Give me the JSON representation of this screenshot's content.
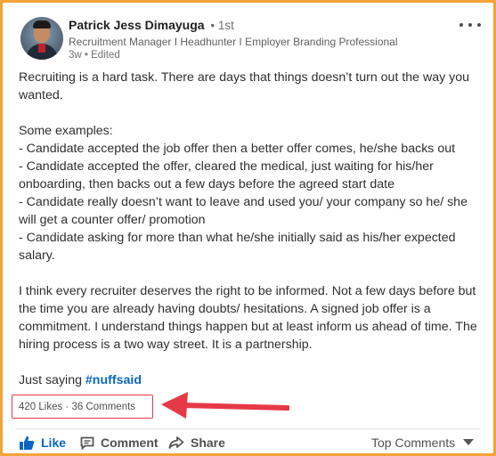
{
  "post": {
    "author": {
      "name": "Patrick Jess Dimayuga",
      "connection_degree": "• 1st",
      "headline": "Recruitment Manager I Headhunter I Employer Branding Professional",
      "meta": "3w • Edited"
    },
    "paragraphs": [
      "Recruiting is a hard task. There are days that things doesn’t turn out the way you wanted.",
      "Some examples:\n- Candidate accepted the job offer then a better offer comes, he/she backs out\n- Candidate accepted the offer, cleared the medical, just waiting for his/her onboarding, then backs out a few days before the agreed start date\n- Candidate really doesn’t want to leave and used you/ your company so he/ she will get a counter offer/ promotion\n- Candidate asking for more than what he/she initially said as his/her expected salary.",
      "I think every recruiter deserves the right to be informed. Not a few days before but the time you are already having doubts/ hesitations. A signed job offer is a commitment. I understand things happen but at least inform us ahead of time. The hiring process is a two way street. It is a partnership."
    ],
    "closing_text": "Just saying ",
    "hashtag": "#nuffsaid",
    "social_counts": "420 Likes · 36 Comments"
  },
  "actions": {
    "like": "Like",
    "comment": "Comment",
    "share": "Share",
    "sort": "Top Comments"
  },
  "colors": {
    "frame_border": "#f2a33a",
    "highlight": "#e53a46",
    "link_blue": "#0a66c2"
  },
  "icons": [
    "more-options-icon",
    "thumbs-up-icon",
    "comment-icon",
    "share-icon",
    "chevron-down-icon",
    "annotation-arrow"
  ]
}
